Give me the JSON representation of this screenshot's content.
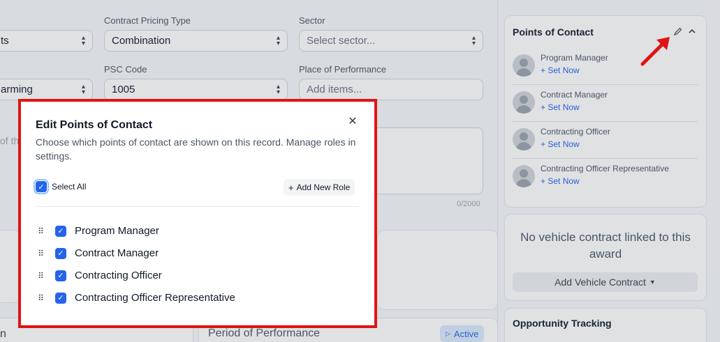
{
  "form": {
    "contract_pricing_type_label": "Contract Pricing Type",
    "contract_pricing_type_value": "Combination",
    "sector_label": "Sector",
    "sector_placeholder": "Select sector...",
    "left_select_1_partial": "ts",
    "psc_code_label": "PSC Code",
    "psc_code_value": "1005",
    "place_of_performance_label": "Place of Performance",
    "place_of_performance_placeholder": "Add items...",
    "left_select_2_partial": "arming",
    "left_text_partial": "of th",
    "char_count": "0/2000",
    "left_bottom_partial": "n",
    "period_of_performance_label": "Period of Performance",
    "active_badge": "Active"
  },
  "right_panel": {
    "poc_title": "Points of Contact",
    "contacts": [
      {
        "role": "Program Manager",
        "action": "Set Now"
      },
      {
        "role": "Contract Manager",
        "action": "Set Now"
      },
      {
        "role": "Contracting Officer",
        "action": "Set Now"
      },
      {
        "role": "Contracting Officer Representative",
        "action": "Set Now"
      }
    ],
    "vehicle_message": "No vehicle contract linked to this award",
    "add_vehicle_label": "Add Vehicle Contract",
    "opportunity_title": "Opportunity Tracking"
  },
  "modal": {
    "title": "Edit Points of Contact",
    "description": "Choose which points of contact are shown on this record. Manage roles in settings.",
    "select_all_label": "Select All",
    "add_role_label": "Add New Role",
    "roles": [
      {
        "label": "Program Manager",
        "checked": true
      },
      {
        "label": "Contract Manager",
        "checked": true
      },
      {
        "label": "Contracting Officer",
        "checked": true
      },
      {
        "label": "Contracting Officer Representative",
        "checked": true
      }
    ]
  },
  "colors": {
    "accent": "#2563eb",
    "highlight_border": "#e01414",
    "arrow": "#e01414"
  }
}
